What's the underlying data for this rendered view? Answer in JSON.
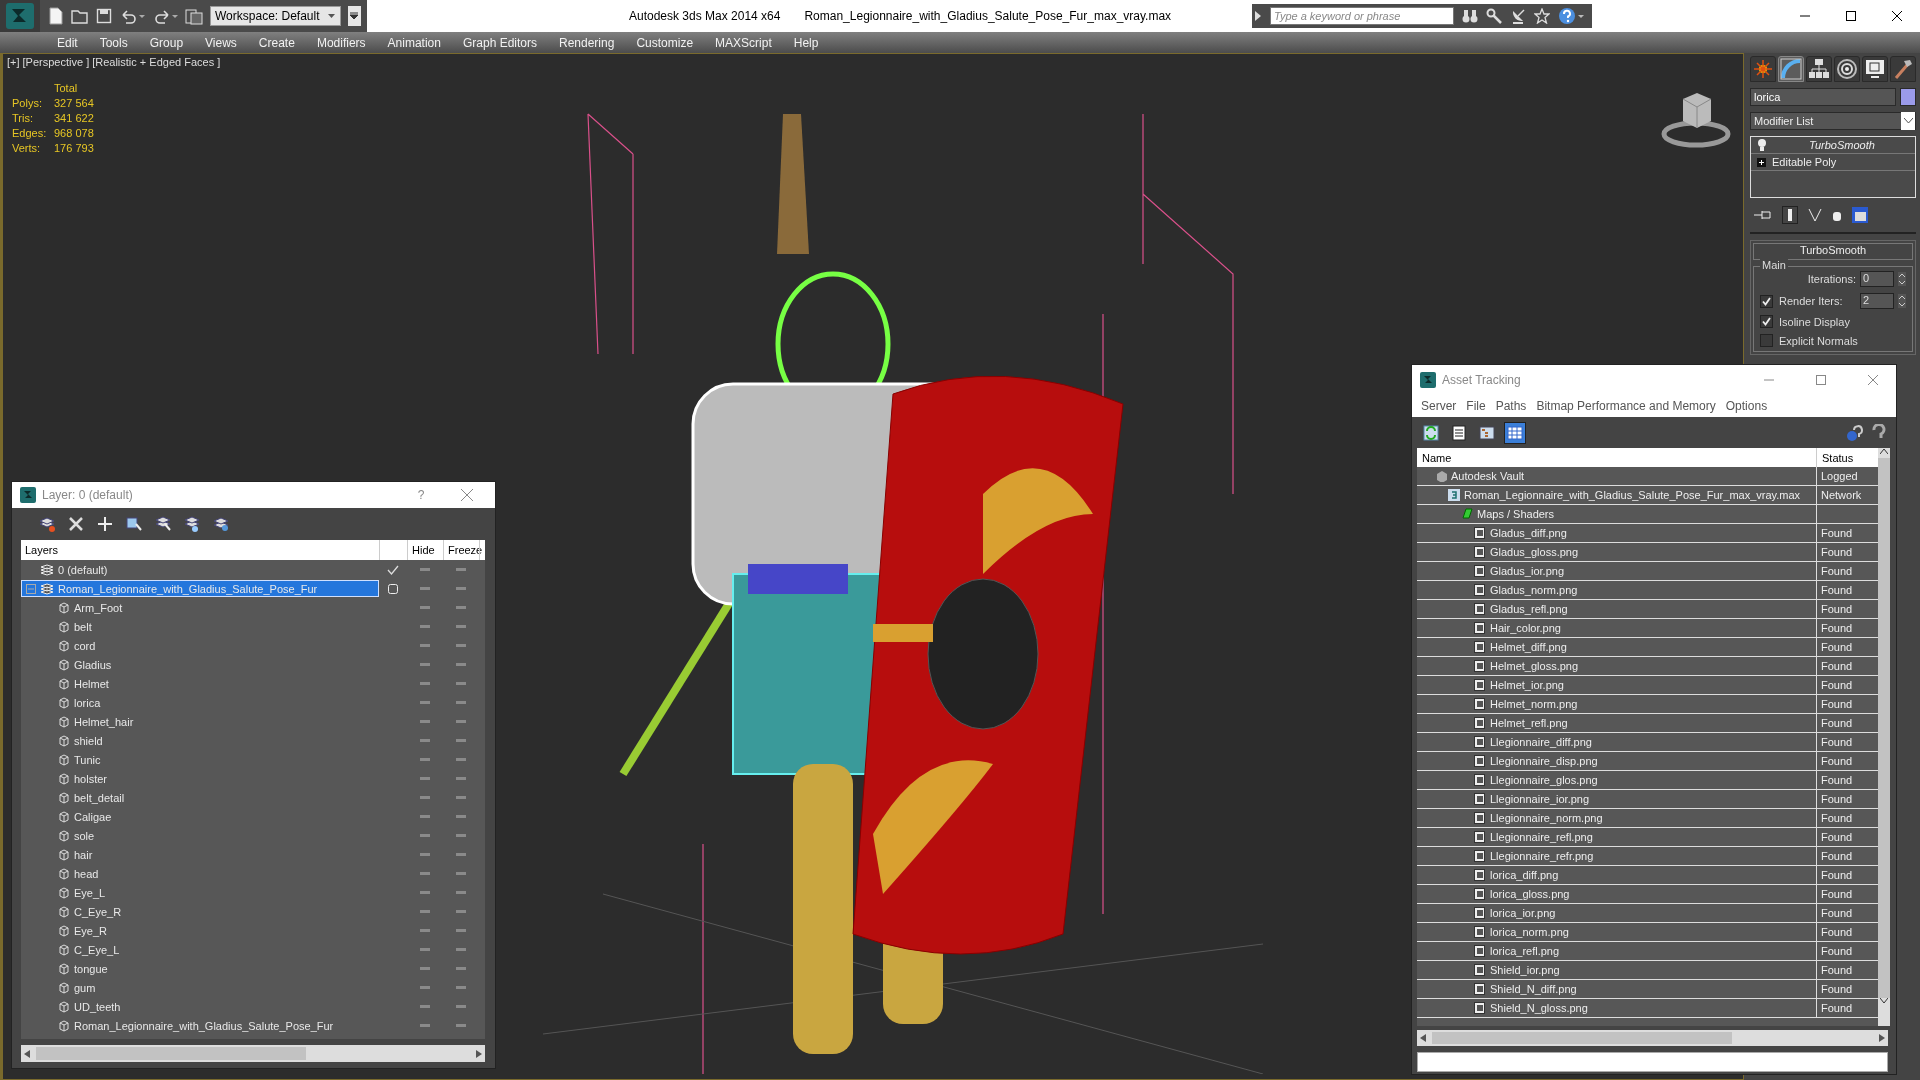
{
  "title_bar": {
    "workspace": "Workspace: Default",
    "app_title": "Autodesk 3ds Max  2014 x64",
    "file_name": "Roman_Legionnaire_with_Gladius_Salute_Pose_Fur_max_vray.max",
    "search": {
      "placeholder": "Type a keyword or phrase"
    }
  },
  "menu_bar": [
    "Edit",
    "Tools",
    "Group",
    "Views",
    "Create",
    "Modifiers",
    "Animation",
    "Graph Editors",
    "Rendering",
    "Customize",
    "MAXScript",
    "Help"
  ],
  "viewport": {
    "labels": [
      "[+]",
      "[Perspective ]",
      "[Realistic + Edged Faces ]"
    ],
    "stats": {
      "heading": "Total",
      "rows": [
        {
          "label": "Polys:",
          "value": "327 564"
        },
        {
          "label": "Tris:",
          "value": "341 622"
        },
        {
          "label": "Edges:",
          "value": "968 078"
        },
        {
          "label": "Verts:",
          "value": "176 793"
        }
      ]
    }
  },
  "command_panel": {
    "tabs": [
      {
        "kind": "create",
        "selected": false
      },
      {
        "kind": "modify",
        "selected": true
      },
      {
        "kind": "hierarchy",
        "selected": false
      },
      {
        "kind": "motion",
        "selected": false
      },
      {
        "kind": "display",
        "selected": false
      },
      {
        "kind": "utilities",
        "selected": false
      }
    ],
    "object_name": "lorica",
    "modifier_list": "Modifier List",
    "stack": [
      {
        "name": "TurboSmooth",
        "kind": "modifier"
      },
      {
        "name": "Editable Poly",
        "kind": "base"
      }
    ],
    "rollout": {
      "title": "TurboSmooth",
      "group": "Main",
      "rows": [
        {
          "kind": "spinner",
          "label": "Iterations:",
          "value": "0"
        },
        {
          "kind": "check_spinner",
          "label": "Render Iters:",
          "value": "2",
          "checked": true
        },
        {
          "kind": "checkbox",
          "label": "Isoline Display",
          "checked": true
        },
        {
          "kind": "checkbox",
          "label": "Explicit Normals",
          "checked": false
        }
      ]
    }
  },
  "layer_window": {
    "title": "Layer: 0 (default)",
    "help": "?",
    "columns": [
      "Layers",
      "Hide",
      "Freeze"
    ],
    "layers": [
      {
        "name": "0 (default)",
        "current": true,
        "selected": false
      },
      {
        "name": "Roman_Legionnaire_with_Gladius_Salute_Pose_Fur",
        "current": false,
        "selected": true,
        "expanded": true,
        "children": [
          {
            "name": "Arm_Foot",
            "selected": false
          },
          {
            "name": "belt",
            "selected": false
          },
          {
            "name": "cord",
            "selected": false
          },
          {
            "name": "Gladius",
            "selected": false
          },
          {
            "name": "Helmet",
            "selected": false
          },
          {
            "name": "lorica",
            "selected": false
          },
          {
            "name": "Helmet_hair",
            "selected": false
          },
          {
            "name": "shield",
            "selected": false
          },
          {
            "name": "Tunic",
            "selected": false
          },
          {
            "name": "holster",
            "selected": false
          },
          {
            "name": "belt_detail",
            "selected": false
          },
          {
            "name": "Caligae",
            "selected": false
          },
          {
            "name": "sole",
            "selected": false
          },
          {
            "name": "hair",
            "selected": false
          },
          {
            "name": "head",
            "selected": false
          },
          {
            "name": "Eye_L",
            "selected": false
          },
          {
            "name": "C_Eye_R",
            "selected": false
          },
          {
            "name": "Eye_R",
            "selected": false
          },
          {
            "name": "C_Eye_L",
            "selected": false
          },
          {
            "name": "tongue",
            "selected": false
          },
          {
            "name": "gum",
            "selected": false
          },
          {
            "name": "UD_teeth",
            "selected": false
          },
          {
            "name": "Roman_Legionnaire_with_Gladius_Salute_Pose_Fur",
            "selected": false
          }
        ]
      }
    ]
  },
  "asset_window": {
    "title": "Asset Tracking",
    "menu": [
      "Server",
      "File",
      "Paths",
      "Bitmap Performance and Memory",
      "Options"
    ],
    "toolbar": [
      {
        "kind": "refresh",
        "selected": false
      },
      {
        "kind": "list",
        "selected": false
      },
      {
        "kind": "tree",
        "selected": false
      },
      {
        "kind": "table",
        "selected": true
      }
    ],
    "columns": [
      "Name",
      "Status"
    ],
    "assets": [
      {
        "name": "Autodesk Vault",
        "status": "Logged",
        "kind": "vault",
        "children": [
          {
            "name": "Roman_Legionnaire_with_Gladius_Salute_Pose_Fur_max_vray.max",
            "status": "Network",
            "kind": "scene",
            "children": [
              {
                "name": "Maps / Shaders",
                "kind": "folder",
                "children": [
                  {
                    "name": "Gladus_diff.png",
                    "status": "Found",
                    "kind": "bitmap"
                  },
                  {
                    "name": "Gladus_gloss.png",
                    "status": "Found",
                    "kind": "bitmap"
                  },
                  {
                    "name": "Gladus_ior.png",
                    "status": "Found",
                    "kind": "bitmap"
                  },
                  {
                    "name": "Gladus_norm.png",
                    "status": "Found",
                    "kind": "bitmap"
                  },
                  {
                    "name": "Gladus_refl.png",
                    "status": "Found",
                    "kind": "bitmap"
                  },
                  {
                    "name": "Hair_color.png",
                    "status": "Found",
                    "kind": "bitmap"
                  },
                  {
                    "name": "Helmet_diff.png",
                    "status": "Found",
                    "kind": "bitmap"
                  },
                  {
                    "name": "Helmet_gloss.png",
                    "status": "Found",
                    "kind": "bitmap"
                  },
                  {
                    "name": "Helmet_ior.png",
                    "status": "Found",
                    "kind": "bitmap"
                  },
                  {
                    "name": "Helmet_norm.png",
                    "status": "Found",
                    "kind": "bitmap"
                  },
                  {
                    "name": "Helmet_refl.png",
                    "status": "Found",
                    "kind": "bitmap"
                  },
                  {
                    "name": "Llegionnaire_diff.png",
                    "status": "Found",
                    "kind": "bitmap"
                  },
                  {
                    "name": "Llegionnaire_disp.png",
                    "status": "Found",
                    "kind": "bitmap"
                  },
                  {
                    "name": "Llegionnaire_glos.png",
                    "status": "Found",
                    "kind": "bitmap"
                  },
                  {
                    "name": "Llegionnaire_ior.png",
                    "status": "Found",
                    "kind": "bitmap"
                  },
                  {
                    "name": "Llegionnaire_norm.png",
                    "status": "Found",
                    "kind": "bitmap"
                  },
                  {
                    "name": "Llegionnaire_refl.png",
                    "status": "Found",
                    "kind": "bitmap"
                  },
                  {
                    "name": "Llegionnaire_refr.png",
                    "status": "Found",
                    "kind": "bitmap"
                  },
                  {
                    "name": "lorica_diff.png",
                    "status": "Found",
                    "kind": "bitmap"
                  },
                  {
                    "name": "lorica_gloss.png",
                    "status": "Found",
                    "kind": "bitmap"
                  },
                  {
                    "name": "lorica_ior.png",
                    "status": "Found",
                    "kind": "bitmap"
                  },
                  {
                    "name": "lorica_norm.png",
                    "status": "Found",
                    "kind": "bitmap"
                  },
                  {
                    "name": "lorica_refl.png",
                    "status": "Found",
                    "kind": "bitmap"
                  },
                  {
                    "name": "Shield_ior.png",
                    "status": "Found",
                    "kind": "bitmap"
                  },
                  {
                    "name": "Shield_N_diff.png",
                    "status": "Found",
                    "kind": "bitmap"
                  },
                  {
                    "name": "Shield_N_gloss.png",
                    "status": "Found",
                    "kind": "bitmap"
                  }
                ]
              }
            ]
          }
        ]
      }
    ]
  }
}
